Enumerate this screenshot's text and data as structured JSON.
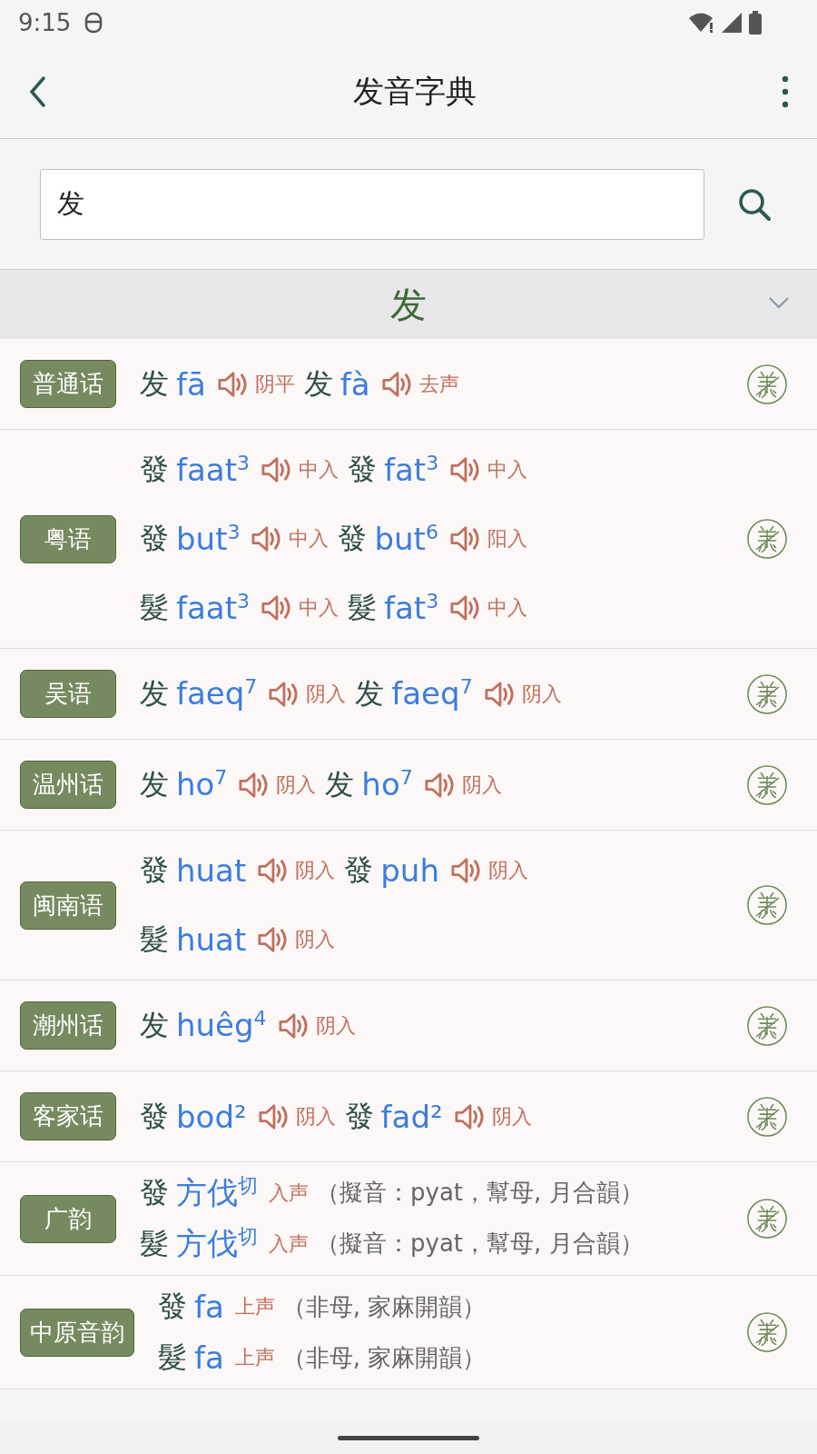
{
  "status_bar": {
    "time": "9:15"
  },
  "app_bar": {
    "title": "发音字典"
  },
  "search": {
    "value": "发"
  },
  "headword": {
    "text": "发",
    "expanded": false
  },
  "rows": [
    {
      "dialect": "普通话",
      "lines": [
        [
          {
            "kind": "audio",
            "char": "发",
            "roman": "fā",
            "tone": "阴平"
          },
          {
            "kind": "audio",
            "char": "发",
            "roman": "fà",
            "tone": "去声"
          }
        ]
      ]
    },
    {
      "dialect": "粤语",
      "lines": [
        [
          {
            "kind": "audio",
            "char": "發",
            "roman": "faat$^{3}$",
            "tone": "中入"
          },
          {
            "kind": "audio",
            "char": "發",
            "roman": "fat$^{3}$",
            "tone": "中入"
          }
        ],
        [
          {
            "kind": "audio",
            "char": "發",
            "roman": "but$^{3}$",
            "tone": "中入"
          },
          {
            "kind": "audio",
            "char": "發",
            "roman": "but$^{6}$",
            "tone": "阳入"
          }
        ],
        [
          {
            "kind": "audio",
            "char": "髮",
            "roman": "faat$^{3}$",
            "tone": "中入"
          },
          {
            "kind": "audio",
            "char": "髮",
            "roman": "fat$^{3}$",
            "tone": "中入"
          }
        ]
      ]
    },
    {
      "dialect": "吴语",
      "lines": [
        [
          {
            "kind": "audio",
            "char": "发",
            "roman": "faeq$^{7}$",
            "tone": "阴入"
          },
          {
            "kind": "audio",
            "char": "发",
            "roman": "faeq$^{7}$",
            "tone": "阴入"
          }
        ]
      ]
    },
    {
      "dialect": "温州话",
      "lines": [
        [
          {
            "kind": "audio",
            "char": "发",
            "roman": "ho$^{7}$",
            "tone": "阴入"
          },
          {
            "kind": "audio",
            "char": "发",
            "roman": "ho$^{7}$",
            "tone": "阴入"
          }
        ]
      ]
    },
    {
      "dialect": "闽南语",
      "lines": [
        [
          {
            "kind": "audio",
            "char": "發",
            "roman": "huat",
            "tone": "阴入"
          },
          {
            "kind": "audio",
            "char": "發",
            "roman": "puh",
            "tone": "阴入"
          }
        ],
        [
          {
            "kind": "audio",
            "char": "髮",
            "roman": "huat",
            "tone": "阴入"
          }
        ]
      ]
    },
    {
      "dialect": "潮州话",
      "lines": [
        [
          {
            "kind": "audio",
            "char": "发",
            "roman": "huêg$^{4}$",
            "tone": "阴入"
          }
        ]
      ]
    },
    {
      "dialect": "客家话",
      "lines": [
        [
          {
            "kind": "audio",
            "char": "發",
            "roman": "bod²",
            "tone": "阴入"
          },
          {
            "kind": "audio",
            "char": "發",
            "roman": "fad²",
            "tone": "阴入"
          }
        ]
      ]
    },
    {
      "dialect": "广韵",
      "lines": [
        [
          {
            "kind": "rhyme",
            "char": "發",
            "roman": "方伐$^{切}$",
            "tone": "入声",
            "note": "（擬音：pyat，幫母, 月合韻）"
          }
        ],
        [
          {
            "kind": "rhyme",
            "char": "髮",
            "roman": "方伐$^{切}$",
            "tone": "入声",
            "note": "（擬音：pyat，幫母, 月合韻）"
          }
        ]
      ]
    },
    {
      "dialect": "中原音韵",
      "lines": [
        [
          {
            "kind": "rhyme",
            "char": "發",
            "roman": "fa",
            "tone": "上声",
            "note": "（非母, 家麻開韻）"
          }
        ],
        [
          {
            "kind": "rhyme",
            "char": "髮",
            "roman": "fa",
            "tone": "上声",
            "note": "（非母, 家麻開韻）"
          }
        ]
      ]
    }
  ]
}
